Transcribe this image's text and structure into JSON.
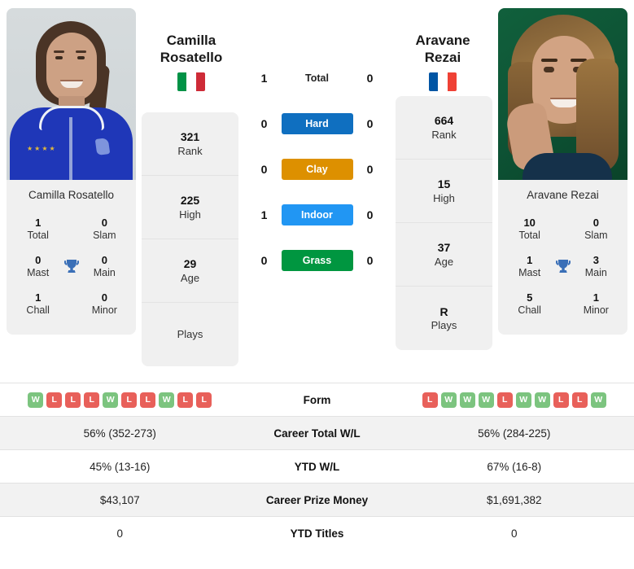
{
  "players": {
    "left": {
      "name_first": "Camilla",
      "name_last": "Rosatello",
      "full_name": "Camilla Rosatello",
      "country": "Italy",
      "flag_colors": [
        "#009246",
        "#ffffff",
        "#ce2b37"
      ],
      "rank": "321",
      "rank_label": "Rank",
      "high": "225",
      "high_label": "High",
      "age": "29",
      "age_label": "Age",
      "plays": "",
      "plays_label": "Plays",
      "titles": {
        "total": "1",
        "total_label": "Total",
        "slam": "0",
        "slam_label": "Slam",
        "mast": "0",
        "mast_label": "Mast",
        "main": "0",
        "main_label": "Main",
        "chall": "1",
        "chall_label": "Chall",
        "minor": "0",
        "minor_label": "Minor"
      },
      "form": [
        "W",
        "L",
        "L",
        "L",
        "W",
        "L",
        "L",
        "W",
        "L",
        "L"
      ],
      "career_total_wl": "56% (352-273)",
      "ytd_wl": "45% (13-16)",
      "career_prize_money": "$43,107",
      "ytd_titles": "0"
    },
    "right": {
      "name_first": "Aravane",
      "name_last": "Rezai",
      "full_name": "Aravane Rezai",
      "country": "France",
      "flag_colors": [
        "#0055a4",
        "#ffffff",
        "#ef4135"
      ],
      "rank": "664",
      "rank_label": "Rank",
      "high": "15",
      "high_label": "High",
      "age": "37",
      "age_label": "Age",
      "plays": "R",
      "plays_label": "Plays",
      "titles": {
        "total": "10",
        "total_label": "Total",
        "slam": "0",
        "slam_label": "Slam",
        "mast": "1",
        "mast_label": "Mast",
        "main": "3",
        "main_label": "Main",
        "chall": "5",
        "chall_label": "Chall",
        "minor": "1",
        "minor_label": "Minor"
      },
      "form": [
        "L",
        "W",
        "W",
        "W",
        "L",
        "W",
        "W",
        "L",
        "L",
        "W"
      ],
      "career_total_wl": "56% (284-225)",
      "ytd_wl": "67% (16-8)",
      "career_prize_money": "$1,691,382",
      "ytd_titles": "0"
    }
  },
  "surfaces": [
    {
      "label": "Total",
      "left": "1",
      "right": "0",
      "color": "",
      "is_bar": false
    },
    {
      "label": "Hard",
      "left": "0",
      "right": "0",
      "color": "#0f6fc0",
      "is_bar": true
    },
    {
      "label": "Clay",
      "left": "0",
      "right": "0",
      "color": "#dd9000",
      "is_bar": true
    },
    {
      "label": "Indoor",
      "left": "1",
      "right": "0",
      "color": "#2196f3",
      "is_bar": true
    },
    {
      "label": "Grass",
      "left": "0",
      "right": "0",
      "color": "#009640",
      "is_bar": true
    }
  ],
  "stats_rows": [
    {
      "label": "Form",
      "left": "",
      "right": "",
      "is_form": true,
      "shaded": false
    },
    {
      "label": "Career Total W/L",
      "left": "56% (352-273)",
      "right": "56% (284-225)",
      "is_form": false,
      "shaded": true
    },
    {
      "label": "YTD W/L",
      "left": "45% (13-16)",
      "right": "67% (16-8)",
      "is_form": false,
      "shaded": false
    },
    {
      "label": "Career Prize Money",
      "left": "$43,107",
      "right": "$1,691,382",
      "is_form": false,
      "shaded": true
    },
    {
      "label": "YTD Titles",
      "left": "0",
      "right": "0",
      "is_form": false,
      "shaded": false
    }
  ],
  "icons": {
    "trophy": "trophy-icon",
    "flag_left": "italy-flag-icon",
    "flag_right": "france-flag-icon"
  },
  "theme": {
    "card_bg": "#f0f0f0",
    "row_shade": "#f2f2f2",
    "win_badge": "#7cc47f",
    "loss_badge": "#e8605a",
    "text": "#1a1a1a"
  }
}
